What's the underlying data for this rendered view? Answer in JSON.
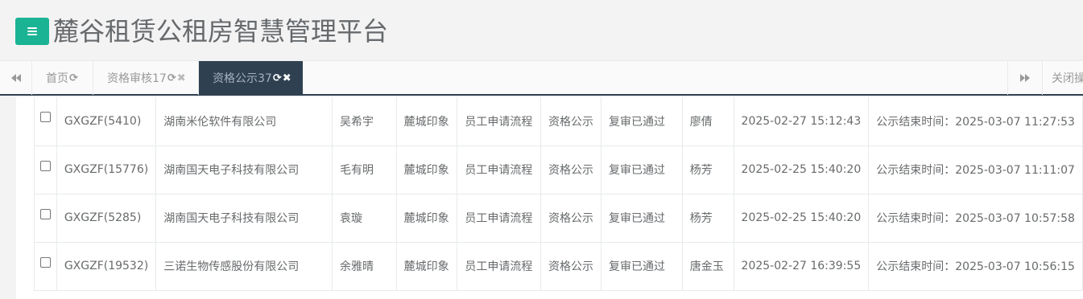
{
  "header": {
    "menu_icon": "hamburger-icon",
    "title": "麓谷租赁公租房智慧管理平台",
    "accent_color": "#1ab394"
  },
  "tabs": {
    "left_nav_icon": "double-chevron-left-icon",
    "right_nav_icon": "double-chevron-right-icon",
    "items": [
      {
        "label": "首页",
        "icons": [
          "refresh-icon"
        ],
        "active": false
      },
      {
        "label": "资格审核17",
        "icons": [
          "refresh-icon",
          "close-icon"
        ],
        "active": false
      },
      {
        "label": "资格公示37",
        "icons": [
          "refresh-icon",
          "close-icon"
        ],
        "active": true
      }
    ],
    "close_ops_label": "关闭操",
    "active_color": "#2f4050"
  },
  "table": {
    "rows": [
      {
        "code": "GXGZF(5410)",
        "company": "湖南米伦软件有限公司",
        "name": "吴希宇",
        "project": "麓城印象",
        "flow": "员工申请流程",
        "stage": "资格公示",
        "status": "复审已通过",
        "operator": "廖倩",
        "time": "2025-02-27 15:12:43",
        "end": "公示结束时间：2025-03-07 11:27:53"
      },
      {
        "code": "GXGZF(15776)",
        "company": "湖南国天电子科技有限公司",
        "name": "毛有明",
        "project": "麓城印象",
        "flow": "员工申请流程",
        "stage": "资格公示",
        "status": "复审已通过",
        "operator": "杨芳",
        "time": "2025-02-25 15:40:20",
        "end": "公示结束时间：2025-03-07 11:11:07"
      },
      {
        "code": "GXGZF(5285)",
        "company": "湖南国天电子科技有限公司",
        "name": "袁璇",
        "project": "麓城印象",
        "flow": "员工申请流程",
        "stage": "资格公示",
        "status": "复审已通过",
        "operator": "杨芳",
        "time": "2025-02-25 15:40:20",
        "end": "公示结束时间：2025-03-07 10:57:58"
      },
      {
        "code": "GXGZF(19532)",
        "company": "三诺生物传感股份有限公司",
        "name": "余雅晴",
        "project": "麓城印象",
        "flow": "员工申请流程",
        "stage": "资格公示",
        "status": "复审已通过",
        "operator": "唐金玉",
        "time": "2025-02-27 16:39:55",
        "end": "公示结束时间：2025-03-07 10:56:15"
      }
    ]
  }
}
